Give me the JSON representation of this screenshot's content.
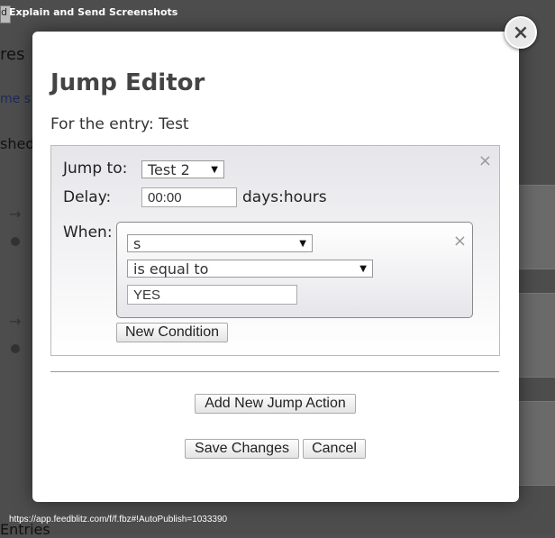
{
  "background": {
    "tab_fragment": "d",
    "title": "Explain and Send Screenshots",
    "frag1": "res",
    "frag2": "me s",
    "frag3": "shed",
    "frag4": "Entries"
  },
  "status_url": "https://app.feedblitz.com/f/f.fbz#!AutoPublish=1033390",
  "modal": {
    "title": "Jump Editor",
    "entry_line": "For the entry: Test",
    "jump_to_label": "Jump to:",
    "jump_to_value": "Test 2",
    "delay_label": "Delay:",
    "delay_value": "00:00",
    "delay_units": "days:hours",
    "when_label": "When:",
    "condition": {
      "field_value": "s",
      "operator_value": "is equal to",
      "compare_value": "YES"
    },
    "new_condition_label": "New Condition",
    "add_jump_label": "Add New Jump Action",
    "save_label": "Save Changes",
    "cancel_label": "Cancel",
    "close_glyph": "×",
    "panel_close_glyph": "×",
    "cond_close_glyph": "×"
  },
  "icons": {
    "close": "close-icon",
    "dropdown": "chevron-down-icon"
  }
}
